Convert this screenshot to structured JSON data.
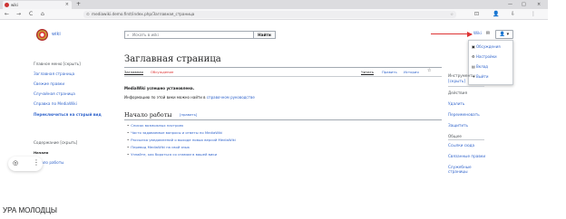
{
  "browser": {
    "tab_title": "wiki",
    "tab_close": "×",
    "new_tab": "+",
    "minimize": "—",
    "maximize": "□",
    "close": "×",
    "back": "←",
    "forward": "→",
    "reload": "C",
    "home": "⌂",
    "url": "mediawiki.demo.first/index.php/Заглавная_страница",
    "bookmark_star": "☆",
    "toolbar_icons": [
      "⊡",
      "👤",
      "⇩",
      "⋮"
    ]
  },
  "site": {
    "logo_text": "wiki",
    "search_placeholder": "Искать в wiki",
    "search_button": "Найти",
    "user_link": "Wiki",
    "notif_icon": "✉",
    "user_icon": "👤",
    "user_menu_chevron": "▾"
  },
  "user_menu": {
    "items": [
      {
        "icon": "▣",
        "label": "Обсуждения"
      },
      {
        "icon": "⚙",
        "label": "Настройки"
      },
      {
        "icon": "▤",
        "label": "Вклад"
      },
      {
        "icon": "⇥",
        "label": "Выйти"
      }
    ]
  },
  "sidebar": {
    "nav": [
      "Главное меню [скрыть]",
      "Заглавная страница",
      "Свежие правки",
      "Случайная страница",
      "Справка по MediaWiki",
      "Переключиться на старый вид"
    ],
    "toc_head": "Содержание [скрыть]",
    "toc_top": "Начало",
    "toc_item": "Начало работы"
  },
  "article": {
    "title": "Заглавная страница",
    "tabs_left": [
      "Заглавная",
      "Обсуждение"
    ],
    "tabs_right": [
      "Читать",
      "Править",
      "История"
    ],
    "watch_star": "☆",
    "installed": "MediaWiki успешно установлена.",
    "info_prefix": "Информацию по этой вики можно найти в ",
    "info_link": "справочном руководстве",
    "h2": "Начало работы",
    "h2_edit": "[править]",
    "bullets": [
      "Список возможных настроек",
      "Часто задаваемые вопросы и ответы по MediaWiki",
      "Рассылка уведомлений о выходе новых версий MediaWiki",
      "Перевод MediaWiki на свой язык",
      "Узнайте, как бороться со спамом в вашей вики"
    ]
  },
  "right_sidebar": {
    "instruments": "Инструменты",
    "hide": "[скрыть]",
    "actions_head": "Действия",
    "actions": [
      "Удалить",
      "Переименовать",
      "Защитить"
    ],
    "general_head": "Общее",
    "general": [
      "Ссылки сюда",
      "Связанные правки",
      "Служебные страницы"
    ]
  },
  "overlay": {
    "lens_icon": "◎",
    "more_icon": "⋮"
  },
  "caption": "УРА МОЛОДЦЫ",
  "colors": {
    "link": "#3366cc",
    "red_link": "#d33",
    "arrow": "#d33"
  }
}
